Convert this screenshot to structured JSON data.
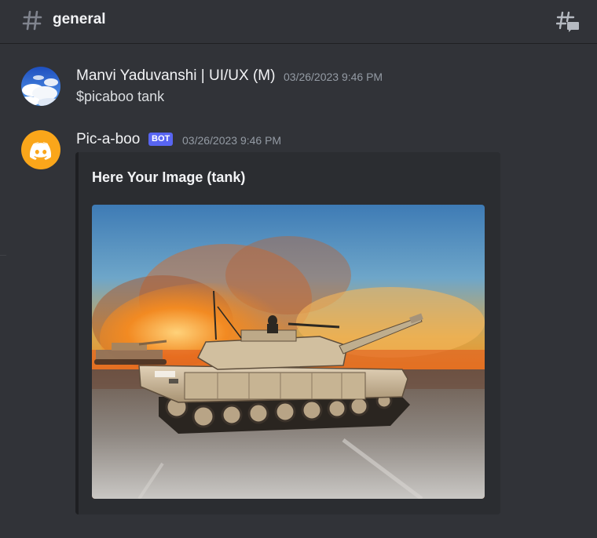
{
  "header": {
    "channel_icon": "hashtag-icon",
    "channel_name": "general",
    "threads_icon": "threads-icon"
  },
  "messages": [
    {
      "username": "Manvi Yaduvanshi | UI/UX (M)",
      "timestamp": "03/26/2023 9:46 PM",
      "content": "$picaboo tank",
      "avatar": "sky-clouds-avatar"
    },
    {
      "username": "Pic-a-boo",
      "badge": "BOT",
      "timestamp": "03/26/2023 9:46 PM",
      "avatar": "discord-logo-avatar",
      "avatar_color": "#faa61a",
      "embed": {
        "title": "Here Your Image (tank)",
        "image": "tank-photo"
      }
    }
  ],
  "colors": {
    "background": "#313338",
    "embed_background": "#2b2d31",
    "bot_badge": "#5865f2"
  }
}
